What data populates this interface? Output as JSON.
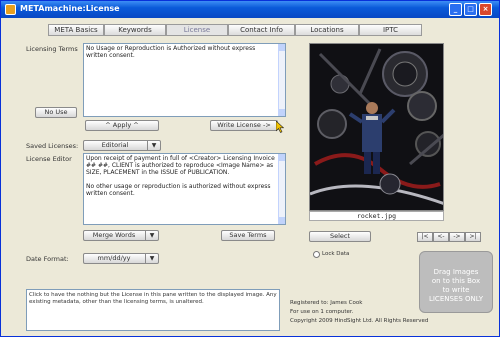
{
  "window": {
    "title": "METAmachine:License"
  },
  "tabs": [
    {
      "label": "META Basics",
      "w": 56
    },
    {
      "label": "Keywords",
      "w": 56
    },
    {
      "label": "License",
      "w": 56
    },
    {
      "label": "Contact Info",
      "w": 64
    },
    {
      "label": "Locations",
      "w": 56
    },
    {
      "label": "IPTC",
      "w": 56
    }
  ],
  "licensing_terms": {
    "label": "Licensing Terms",
    "value": "No Usage or Reproduction is Authorized without express written consent.",
    "no_use_button": "No Use",
    "apply_button": "^ Apply ^",
    "write_license_button": "Write License ->"
  },
  "saved_licenses": {
    "label": "Saved Licenses:",
    "selected": "Editorial"
  },
  "license_editor": {
    "label": "License Editor",
    "text_line1": "Upon receipt of payment in full of <Creator> Licensing Invoice ## ##, CLIENT is authorized to reproduce <Image Name> as SIZE, PLACEMENT in the ISSUE of PUBLICATION.",
    "text_line2": "No other usage or reproduction is authorized without express written consent.",
    "merge_words_button": "Merge Words",
    "save_terms_button": "Save Terms"
  },
  "date_format": {
    "label": "Date Format:",
    "selected": "mm/dd/yy"
  },
  "image": {
    "caption": "rocket.jpg",
    "select_button": "Select",
    "lock_label": "Lock Data"
  },
  "nav": [
    "|<",
    "<-",
    "->",
    ">|"
  ],
  "status_text": "Click to have the nothing but the License in this pane written to the displayed image. Any existing metadata, other than the licensing terms, is unaltered.",
  "registration": {
    "line1": "Registered to: James Cook",
    "line2": "For use on 1 computer.",
    "line3": "Copyright 2009 HindSight Ltd. All Rights Reserved"
  },
  "dropzone": {
    "line1": "Drag Images",
    "line2": "on to this Box",
    "line3": "to write",
    "line4": "LICENSES ONLY"
  }
}
